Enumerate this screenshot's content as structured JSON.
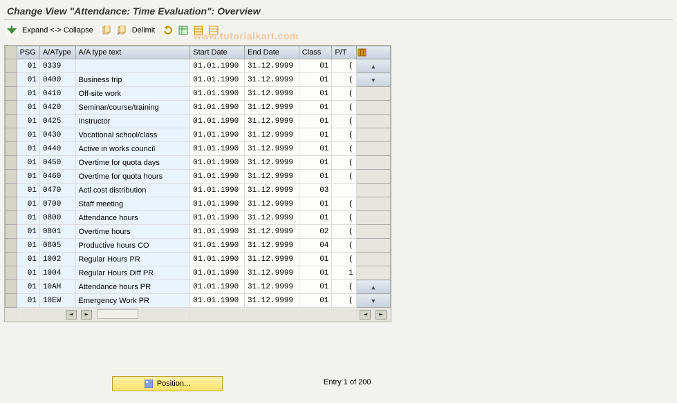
{
  "title": "Change View \"Attendance: Time Evaluation\": Overview",
  "toolbar": {
    "expand": "Expand <-> Collapse",
    "delimit": "Delimit"
  },
  "watermark": "www.tutorialkart.com",
  "columns": {
    "psg": "PSG",
    "aatype": "A/AType",
    "text": "A/A type text",
    "sdate": "Start Date",
    "edate": "End Date",
    "class": "Class",
    "pt": "P/T"
  },
  "rows": [
    {
      "psg": "01",
      "aatype": "0339",
      "text": "",
      "sdate": "01.01.1990",
      "edate": "31.12.9999",
      "class": "01",
      "pt": "("
    },
    {
      "psg": "01",
      "aatype": "0400",
      "text": "Business trip",
      "sdate": "01.01.1990",
      "edate": "31.12.9999",
      "class": "01",
      "pt": "("
    },
    {
      "psg": "01",
      "aatype": "0410",
      "text": "Off-site work",
      "sdate": "01.01.1990",
      "edate": "31.12.9999",
      "class": "01",
      "pt": "("
    },
    {
      "psg": "01",
      "aatype": "0420",
      "text": "Seminar/course/training",
      "sdate": "01.01.1990",
      "edate": "31.12.9999",
      "class": "01",
      "pt": "("
    },
    {
      "psg": "01",
      "aatype": "0425",
      "text": "Instructor",
      "sdate": "01.01.1990",
      "edate": "31.12.9999",
      "class": "01",
      "pt": "("
    },
    {
      "psg": "01",
      "aatype": "0430",
      "text": "Vocational school/class",
      "sdate": "01.01.1990",
      "edate": "31.12.9999",
      "class": "01",
      "pt": "("
    },
    {
      "psg": "01",
      "aatype": "0440",
      "text": "Active in works council",
      "sdate": "01.01.1990",
      "edate": "31.12.9999",
      "class": "01",
      "pt": "("
    },
    {
      "psg": "01",
      "aatype": "0450",
      "text": "Overtime for quota days",
      "sdate": "01.01.1990",
      "edate": "31.12.9999",
      "class": "01",
      "pt": "("
    },
    {
      "psg": "01",
      "aatype": "0460",
      "text": "Overtime for quota hours",
      "sdate": "01.01.1990",
      "edate": "31.12.9999",
      "class": "01",
      "pt": "("
    },
    {
      "psg": "01",
      "aatype": "0470",
      "text": "Actl cost distribution",
      "sdate": "01.01.1990",
      "edate": "31.12.9999",
      "class": "03",
      "pt": ""
    },
    {
      "psg": "01",
      "aatype": "0700",
      "text": "Staff meeting",
      "sdate": "01.01.1990",
      "edate": "31.12.9999",
      "class": "01",
      "pt": "("
    },
    {
      "psg": "01",
      "aatype": "0800",
      "text": "Attendance hours",
      "sdate": "01.01.1990",
      "edate": "31.12.9999",
      "class": "01",
      "pt": "("
    },
    {
      "psg": "01",
      "aatype": "0801",
      "text": "Overtime hours",
      "sdate": "01.01.1990",
      "edate": "31.12.9999",
      "class": "02",
      "pt": "("
    },
    {
      "psg": "01",
      "aatype": "0805",
      "text": "Productive hours CO",
      "sdate": "01.01.1990",
      "edate": "31.12.9999",
      "class": "04",
      "pt": "("
    },
    {
      "psg": "01",
      "aatype": "1002",
      "text": "Regular Hours PR",
      "sdate": "01.01.1990",
      "edate": "31.12.9999",
      "class": "01",
      "pt": "("
    },
    {
      "psg": "01",
      "aatype": "1004",
      "text": "Regular Hours Diff PR",
      "sdate": "01.01.1990",
      "edate": "31.12.9999",
      "class": "01",
      "pt": "1"
    },
    {
      "psg": "01",
      "aatype": "10AH",
      "text": "Attendance hours PR",
      "sdate": "01.01.1990",
      "edate": "31.12.9999",
      "class": "01",
      "pt": "("
    },
    {
      "psg": "01",
      "aatype": "10EW",
      "text": "Emergency Work PR",
      "sdate": "01.01.1990",
      "edate": "31.12.9999",
      "class": "01",
      "pt": "("
    }
  ],
  "position_button": "Position...",
  "entry_status": "Entry 1 of 200"
}
